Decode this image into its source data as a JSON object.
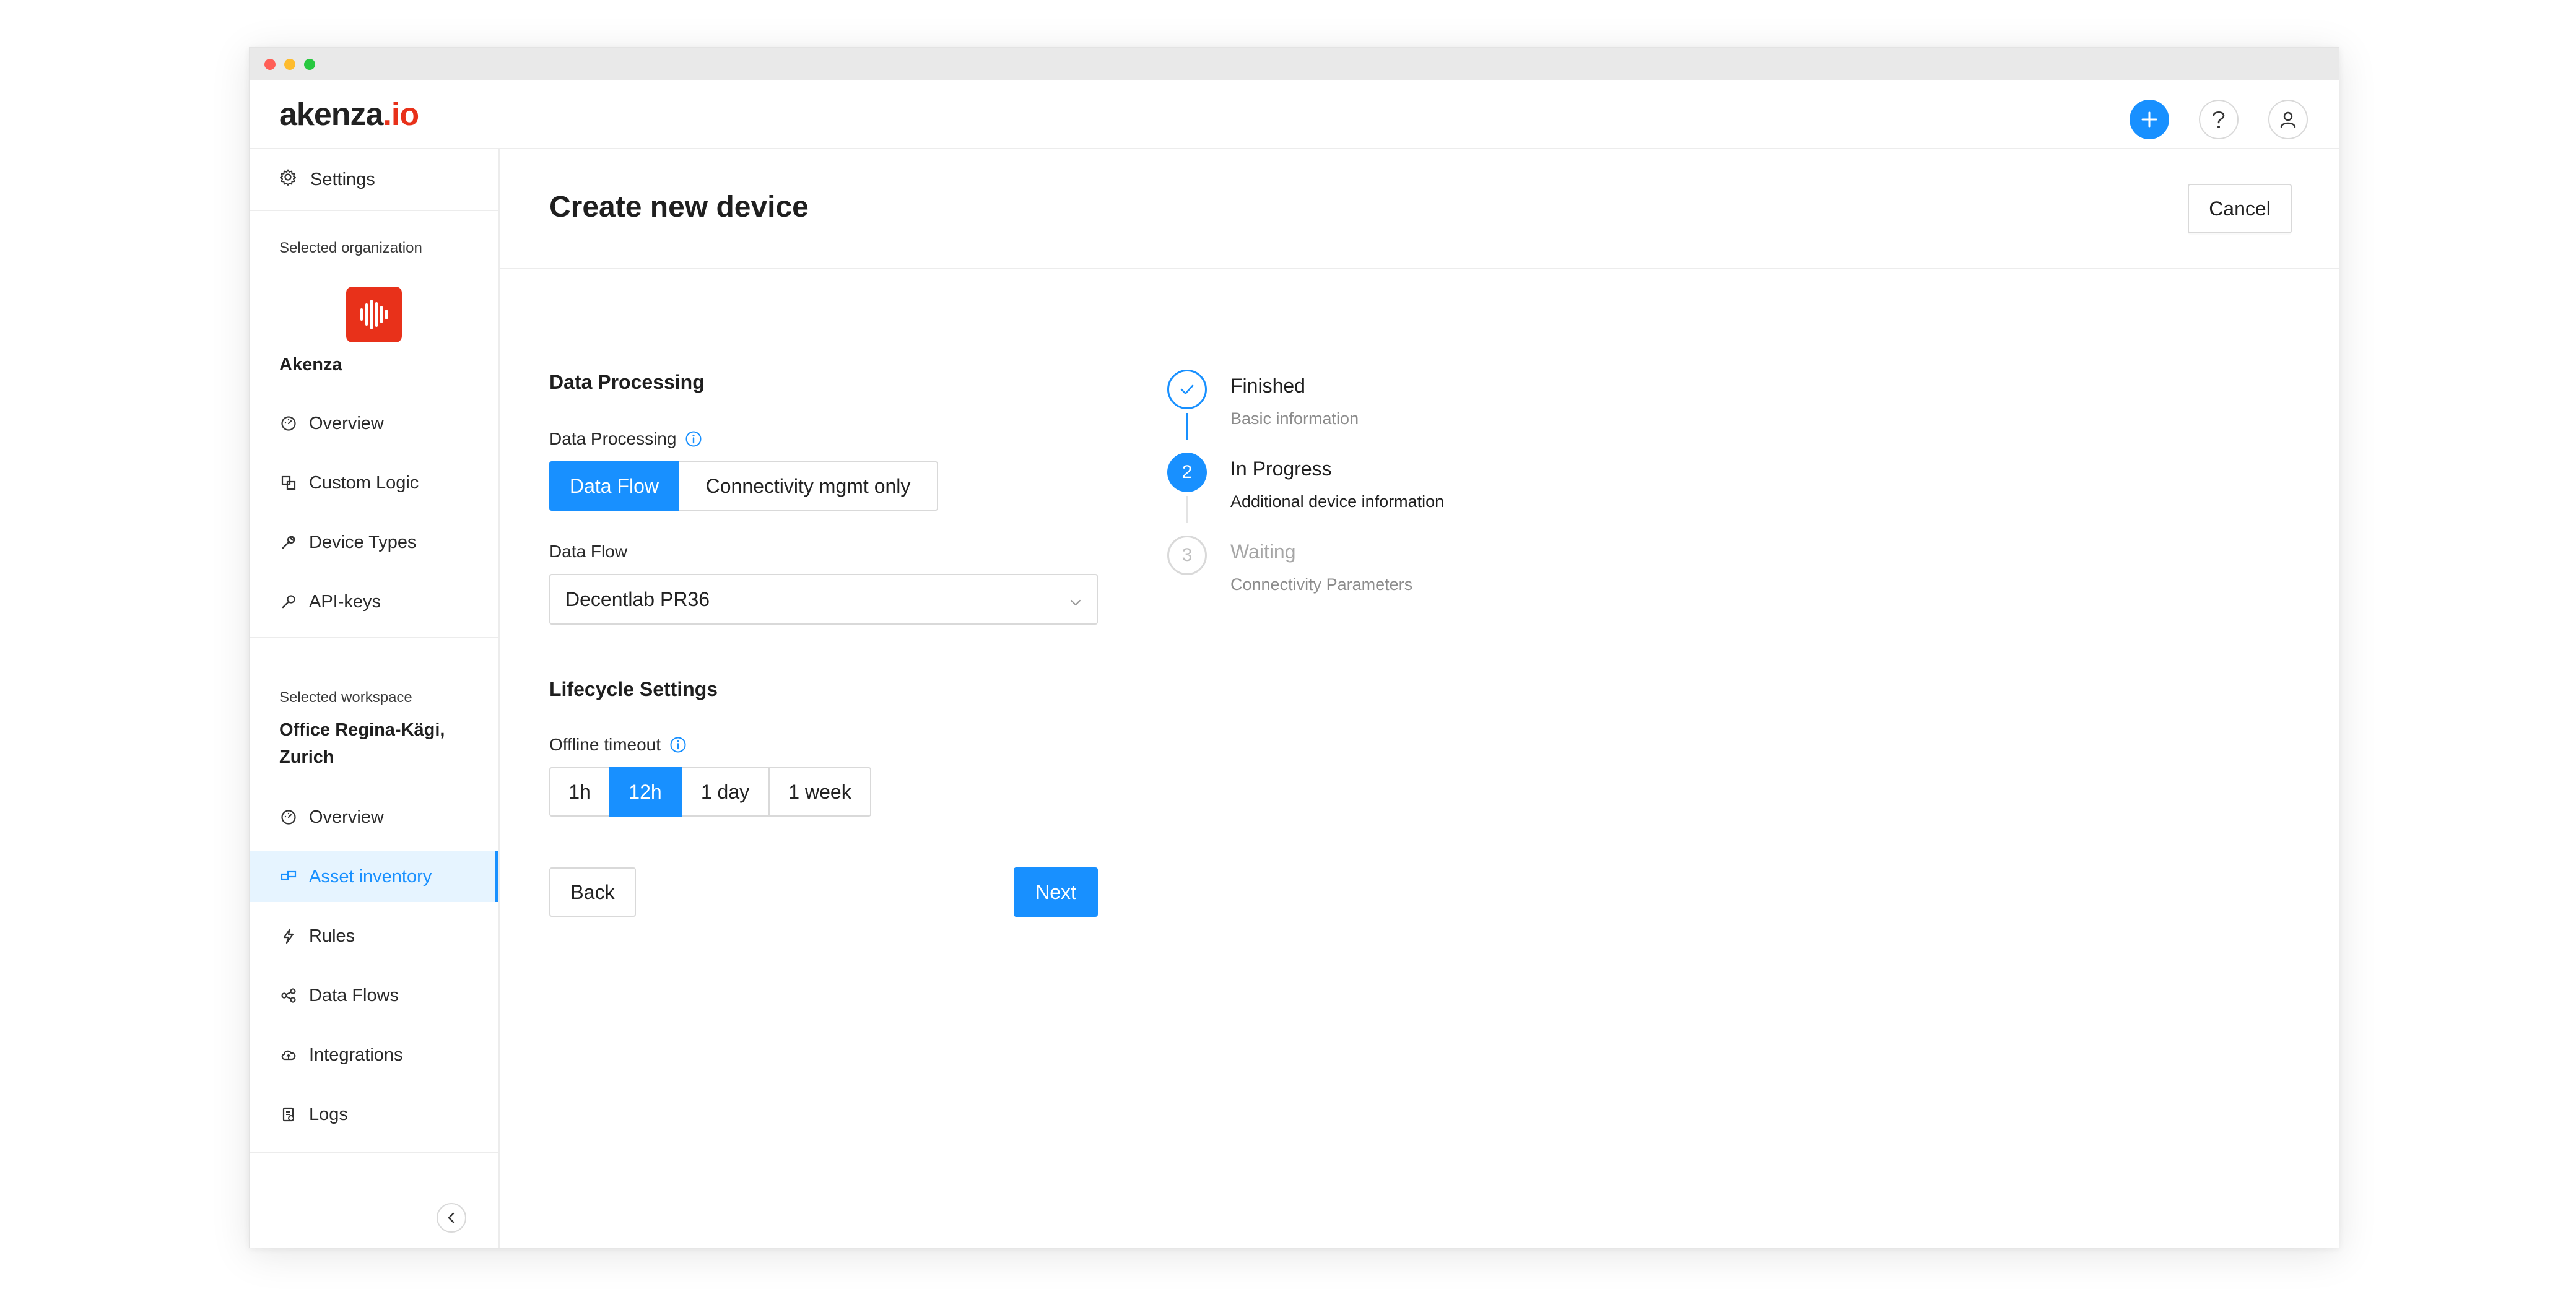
{
  "app": {
    "logo_main": "akenza",
    "logo_suffix": ".io"
  },
  "topbar": {
    "add_icon": "plus-icon",
    "help_icon": "question-icon",
    "user_icon": "user-icon",
    "add_color": "#1890ff"
  },
  "sidebar": {
    "settings_label": "Settings",
    "org_caption": "Selected organization",
    "org_name": "Akenza",
    "org_items": [
      {
        "label": "Overview",
        "icon": "dashboard-icon"
      },
      {
        "label": "Custom Logic",
        "icon": "custom-logic-icon"
      },
      {
        "label": "Device Types",
        "icon": "wrench-icon"
      },
      {
        "label": "API-keys",
        "icon": "key-icon"
      }
    ],
    "workspace_caption": "Selected workspace",
    "workspace_name": "Office Regina-Kägi, Zurich",
    "workspace_items": [
      {
        "label": "Overview",
        "icon": "dashboard-icon"
      },
      {
        "label": "Asset inventory",
        "icon": "asset-icon",
        "active": true
      },
      {
        "label": "Rules",
        "icon": "lightning-icon"
      },
      {
        "label": "Data Flows",
        "icon": "share-icon"
      },
      {
        "label": "Integrations",
        "icon": "cloud-icon"
      },
      {
        "label": "Logs",
        "icon": "logs-icon"
      }
    ],
    "collapse_icon": "chevron-left-icon"
  },
  "main": {
    "title": "Create new device",
    "cancel_label": "Cancel",
    "data_processing": {
      "section_title": "Data Processing",
      "field_label": "Data Processing",
      "options": [
        "Data Flow",
        "Connectivity mgmt only"
      ],
      "selected": "Data Flow"
    },
    "data_flow": {
      "field_label": "Data Flow",
      "value": "Decentlab PR36"
    },
    "lifecycle": {
      "section_title": "Lifecycle Settings",
      "field_label": "Offline timeout",
      "options": [
        "1h",
        "12h",
        "1 day",
        "1 week"
      ],
      "selected": "12h"
    },
    "back_label": "Back",
    "next_label": "Next",
    "accent_color": "#1890ff"
  },
  "steps": [
    {
      "status": "Finished",
      "description": "Basic information",
      "number": "1"
    },
    {
      "status": "In Progress",
      "description": "Additional device information",
      "number": "2"
    },
    {
      "status": "Waiting",
      "description": "Connectivity Parameters",
      "number": "3"
    }
  ]
}
